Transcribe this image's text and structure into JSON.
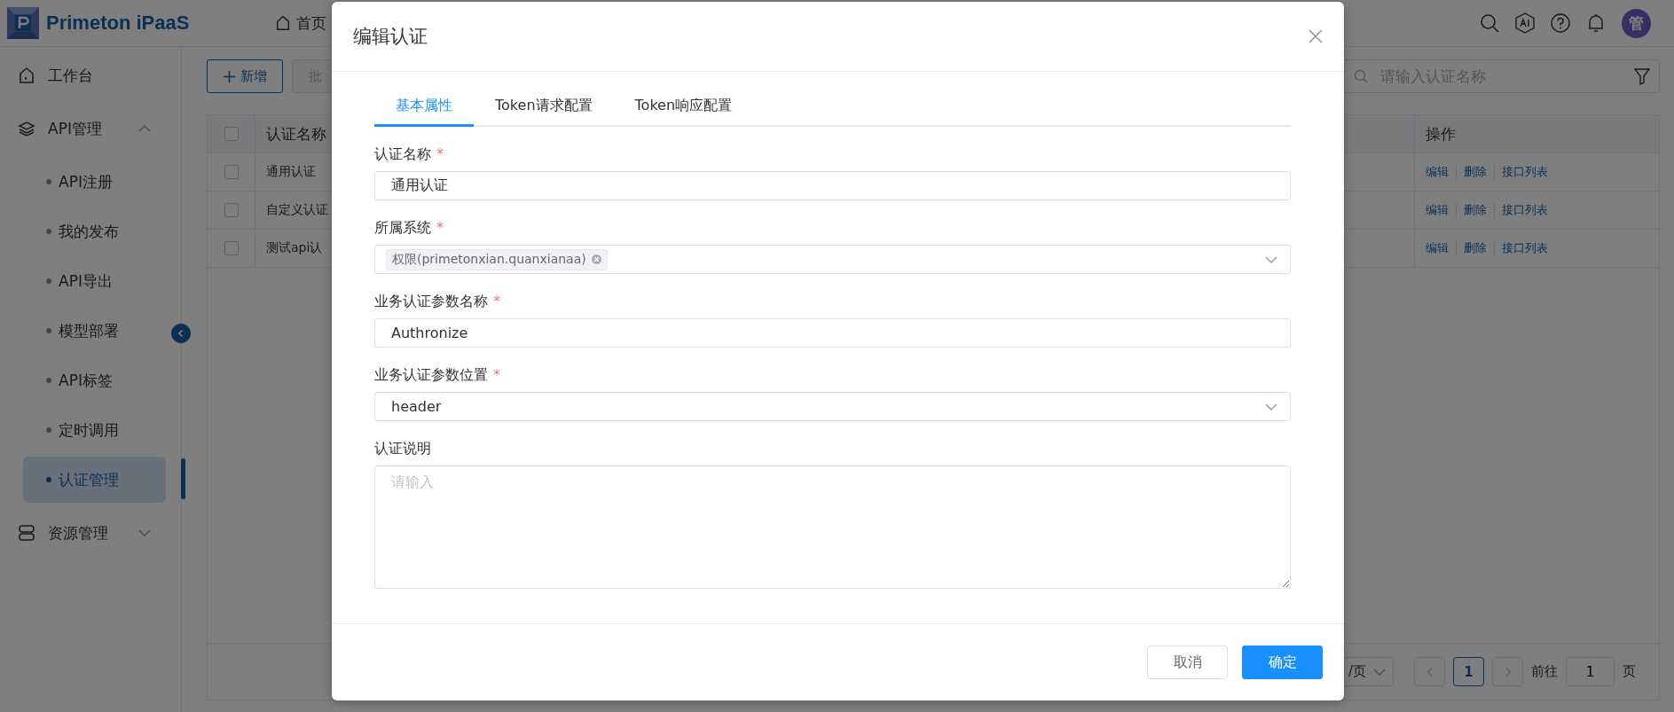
{
  "header": {
    "brand": "Primeton iPaaS",
    "nav_tab": "首页",
    "avatar": "管"
  },
  "sidebar": {
    "items": [
      {
        "label": "工作台",
        "kind": "link"
      },
      {
        "label": "API管理",
        "kind": "group",
        "expanded": true,
        "children": [
          {
            "label": "API注册",
            "selected": false
          },
          {
            "label": "我的发布",
            "selected": false
          },
          {
            "label": "API导出",
            "selected": false
          },
          {
            "label": "模型部署",
            "selected": false
          },
          {
            "label": "API标签",
            "selected": false
          },
          {
            "label": "定时调用",
            "selected": false
          },
          {
            "label": "认证管理",
            "selected": true
          }
        ]
      },
      {
        "label": "资源管理",
        "kind": "group",
        "expanded": false
      }
    ]
  },
  "toolbar": {
    "add_button": "新增",
    "batch_button": "批",
    "search": {
      "placeholder": "请输入认证名称"
    }
  },
  "table": {
    "columns": [
      "认证名称",
      "操作"
    ],
    "all_checked": false,
    "rows": [
      {
        "name": "通用认证",
        "checked": false,
        "actions": [
          "编辑",
          "删除",
          "接口列表"
        ]
      },
      {
        "name": "自定义认证",
        "checked": false,
        "actions": [
          "编辑",
          "删除",
          "接口列表"
        ]
      },
      {
        "name": "测试api认",
        "checked": false,
        "actions": [
          "编辑",
          "删除",
          "接口列表"
        ]
      }
    ]
  },
  "pagination": {
    "page_size": "/页",
    "pages": [
      {
        "label": "1",
        "selected": true
      }
    ],
    "goto_label": "前往",
    "goto_value": "1",
    "goto_suffix": "页"
  },
  "dialog": {
    "title": "编辑认证",
    "tabs": [
      {
        "label": "基本属性",
        "selected": true
      },
      {
        "label": "Token请求配置",
        "selected": false
      },
      {
        "label": "Token响应配置",
        "selected": false
      }
    ],
    "fields": [
      {
        "label": "认证名称",
        "required_mark": "*",
        "kind": "input",
        "value": "通用认证"
      },
      {
        "label": "所属系统",
        "required_mark": "*",
        "kind": "tags",
        "tags": [
          "权限(primetonxian.quanxianaa)"
        ]
      },
      {
        "label": "业务认证参数名称",
        "required_mark": "*",
        "kind": "input",
        "value": "Authronize"
      },
      {
        "label": "业务认证参数位置",
        "required_mark": "*",
        "kind": "select",
        "value": "header"
      },
      {
        "label": "认证说明",
        "kind": "textarea",
        "placeholder": "请输入"
      }
    ],
    "buttons": [
      {
        "label": "取消",
        "kind": "secondary"
      },
      {
        "label": "确定",
        "kind": "primary"
      }
    ]
  }
}
